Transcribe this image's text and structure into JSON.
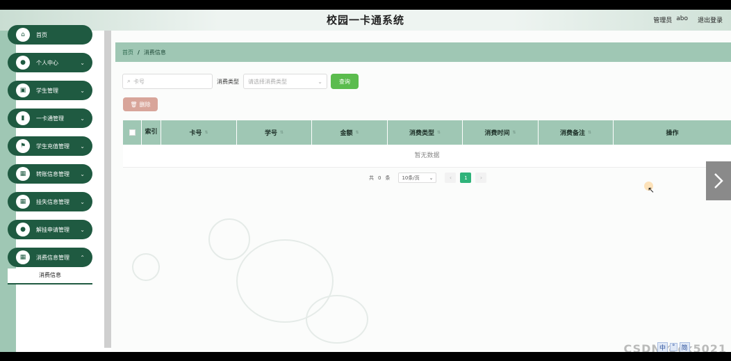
{
  "header": {
    "title": "校园一卡通系统",
    "user_role": "管理员",
    "username": "abo",
    "logout_label": "退出登录"
  },
  "sidebar": {
    "items": [
      {
        "label": "首页",
        "icon": "home-icon",
        "has_children": false
      },
      {
        "label": "个人中心",
        "icon": "user-icon",
        "has_children": true
      },
      {
        "label": "学生管理",
        "icon": "bag-icon",
        "has_children": true
      },
      {
        "label": "一卡通管理",
        "icon": "chart-icon",
        "has_children": true
      },
      {
        "label": "学生充值管理",
        "icon": "flag-icon",
        "has_children": true
      },
      {
        "label": "转账信息管理",
        "icon": "grid-icon",
        "has_children": true
      },
      {
        "label": "挂失信息管理",
        "icon": "grid-icon",
        "has_children": true
      },
      {
        "label": "解挂申请管理",
        "icon": "user-icon",
        "has_children": true
      },
      {
        "label": "消费信息管理",
        "icon": "grid-icon",
        "has_children": true
      }
    ],
    "active_sub_item": "消费信息"
  },
  "breadcrumb": {
    "home": "首页",
    "separator": "/",
    "current": "消费信息"
  },
  "search": {
    "card_placeholder": "卡号",
    "type_label": "消费类型",
    "type_placeholder": "请选择消费类型",
    "query_label": "查询"
  },
  "actions": {
    "delete_label": "删除"
  },
  "table": {
    "columns": [
      "索引",
      "卡号",
      "学号",
      "金额",
      "消费类型",
      "消费时间",
      "消费备注",
      "操作"
    ],
    "empty_text": "暂无数据"
  },
  "pagination": {
    "total_prefix": "共",
    "total": "0",
    "total_suffix": "条",
    "page_size": "10条/页",
    "current_page": "1"
  },
  "overlay": {
    "watermark": "CSDN @ck5021",
    "ime": [
      "中",
      "°",
      "简"
    ]
  },
  "colors": {
    "accent": "#1f5a41",
    "header_green": "#9fc7b4",
    "query_btn": "#5bbc4e",
    "delete_btn": "#d8a59a",
    "page_active": "#2fb37a"
  }
}
